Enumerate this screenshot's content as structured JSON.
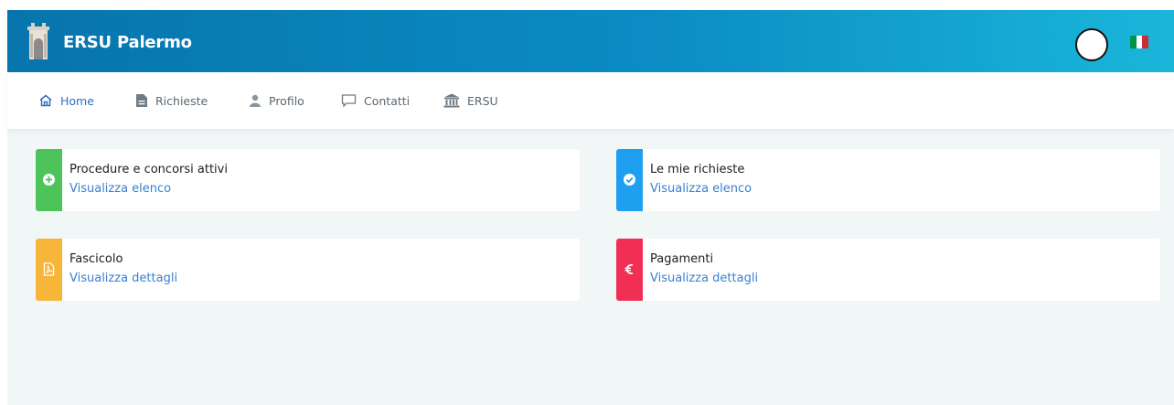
{
  "header": {
    "brand": "ERSU Palermo",
    "colors": {
      "gradient_start": "#0774ad",
      "gradient_end": "#1ab6da"
    },
    "flag": {
      "name": "italy-flag-icon",
      "colors": [
        "#009246",
        "#ffffff",
        "#ce2b37"
      ]
    }
  },
  "nav": {
    "items": [
      {
        "label": "Home",
        "icon": "home-icon",
        "active": true
      },
      {
        "label": "Richieste",
        "icon": "document-icon",
        "active": false
      },
      {
        "label": "Profilo",
        "icon": "user-icon",
        "active": false
      },
      {
        "label": "Contatti",
        "icon": "chat-icon",
        "active": false
      },
      {
        "label": "ERSU",
        "icon": "institution-icon",
        "active": false
      }
    ],
    "colors": {
      "active": "#2c6fc5",
      "inactive": "#5b6770"
    }
  },
  "cards": [
    {
      "title": "Procedure e concorsi attivi",
      "link": "Visualizza elenco",
      "color": "#4cc45a",
      "icon": "plus-circle-icon"
    },
    {
      "title": "Le mie richieste",
      "link": "Visualizza elenco",
      "color": "#1e9ff0",
      "icon": "check-circle-icon"
    },
    {
      "title": "Fascicolo",
      "link": "Visualizza dettagli",
      "color": "#f7b53a",
      "icon": "pdf-file-icon"
    },
    {
      "title": "Pagamenti",
      "link": "Visualizza dettagli",
      "color": "#f12f55",
      "icon": "euro-icon"
    }
  ]
}
